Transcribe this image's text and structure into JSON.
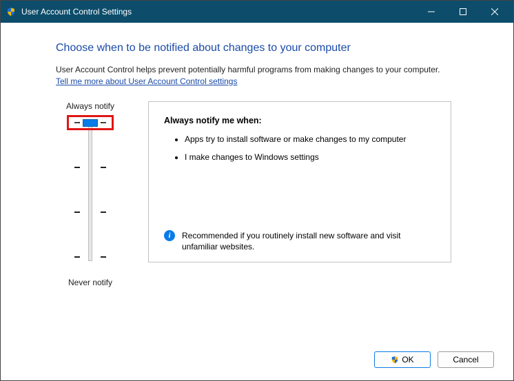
{
  "window": {
    "title": "User Account Control Settings"
  },
  "page": {
    "heading": "Choose when to be notified about changes to your computer",
    "description": "User Account Control helps prevent potentially harmful programs from making changes to your computer.",
    "link": "Tell me more about User Account Control settings"
  },
  "slider": {
    "top_label": "Always notify",
    "bottom_label": "Never notify",
    "levels": 4,
    "current_index": 0
  },
  "panel": {
    "title": "Always notify me when:",
    "bullet1": "Apps try to install software or make changes to my computer",
    "bullet2": "I make changes to Windows settings",
    "info_glyph": "i",
    "recommendation": "Recommended if you routinely install new software and visit unfamiliar websites."
  },
  "buttons": {
    "ok": "OK",
    "cancel": "Cancel"
  }
}
